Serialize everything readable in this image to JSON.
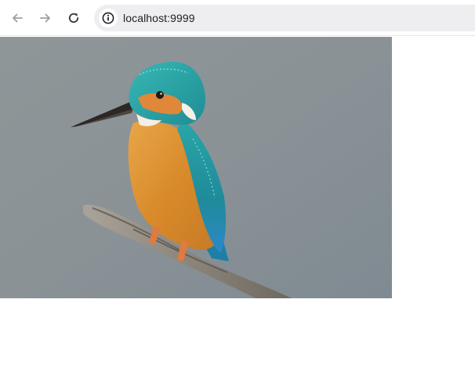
{
  "browser": {
    "address_bar": {
      "url": "localhost:9999"
    },
    "icons": {
      "back": "arrow-left-icon",
      "forward": "arrow-right-icon",
      "reload": "reload-icon",
      "site_info": "info-icon"
    }
  },
  "page": {
    "image": {
      "subject": "kingfisher-photo"
    }
  },
  "colors": {
    "toolbar_bg": "#ffffff",
    "omnibox_bg": "#eeedf0",
    "icon_disabled": "#9aa0a6",
    "icon_active": "#3c4043",
    "photo_bg": "#8d9598"
  }
}
